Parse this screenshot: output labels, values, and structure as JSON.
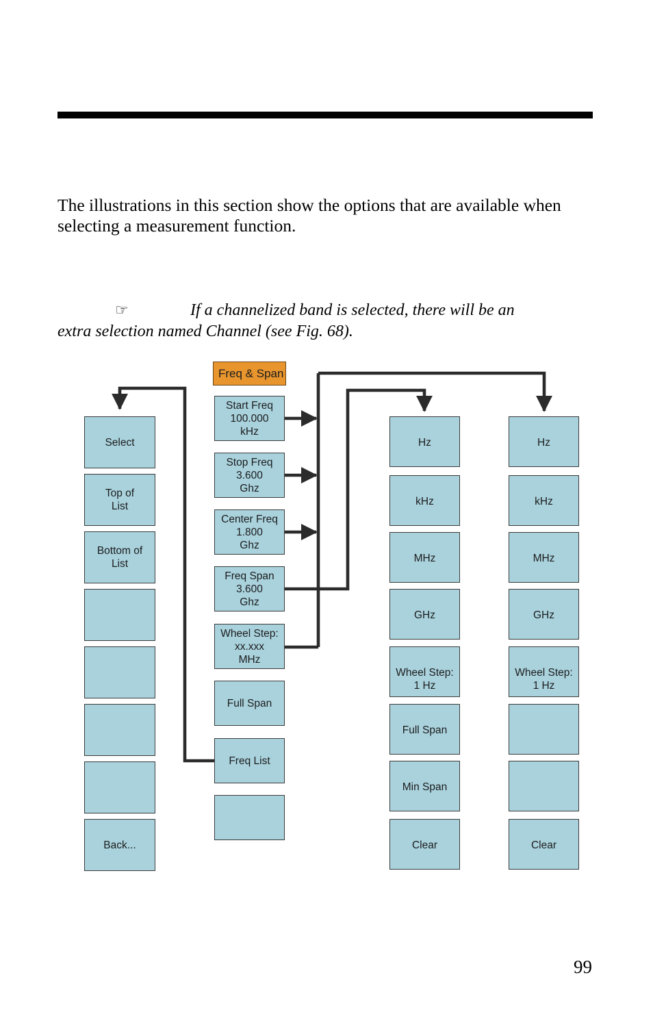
{
  "page": {
    "number": "99",
    "body_paragraph": "The illustrations in this section show the options that are available when selecting a measurement function.",
    "note_icon": "☞",
    "note_line1": "If a channelized band is selected, there will be an",
    "note_line2": "extra selection named Channel (see Fig. 68)."
  },
  "diagram": {
    "header": {
      "label": "Freq & Span",
      "fill": "#e8952e"
    },
    "box_fill": "#a9d2dd",
    "box_stroke": "#3a3a3a",
    "columns": [
      {
        "name": "freq-list-submenu",
        "items": [
          {
            "label": "Select"
          },
          {
            "label": "Top of\nList"
          },
          {
            "label": "Bottom of\nList"
          },
          {
            "label": ""
          },
          {
            "label": ""
          },
          {
            "label": ""
          },
          {
            "label": ""
          },
          {
            "label": "Back..."
          }
        ]
      },
      {
        "name": "freq-span-menu",
        "items": [
          {
            "label": "Start Freq\n100.000\nkHz"
          },
          {
            "label": "Stop Freq\n3.600\nGhz"
          },
          {
            "label": "Center Freq\n1.800\nGhz"
          },
          {
            "label": "Freq Span\n3.600\nGhz"
          },
          {
            "label": "Wheel Step:\nxx.xxx\nMHz"
          },
          {
            "label": "Full Span"
          },
          {
            "label": "Freq List"
          },
          {
            "label": ""
          }
        ]
      },
      {
        "name": "units-menu-span",
        "items": [
          {
            "label": "Hz"
          },
          {
            "label": "kHz"
          },
          {
            "label": "MHz"
          },
          {
            "label": "GHz"
          },
          {
            "label": "Wheel Step:\n1 Hz"
          },
          {
            "label": "Full Span"
          },
          {
            "label": "Min Span"
          },
          {
            "label": "Clear"
          }
        ]
      },
      {
        "name": "units-menu-wheel",
        "items": [
          {
            "label": "Hz"
          },
          {
            "label": "kHz"
          },
          {
            "label": "MHz"
          },
          {
            "label": "GHz"
          },
          {
            "label": "Wheel Step:\n1 Hz"
          },
          {
            "label": ""
          },
          {
            "label": ""
          },
          {
            "label": "Clear"
          }
        ]
      }
    ]
  }
}
